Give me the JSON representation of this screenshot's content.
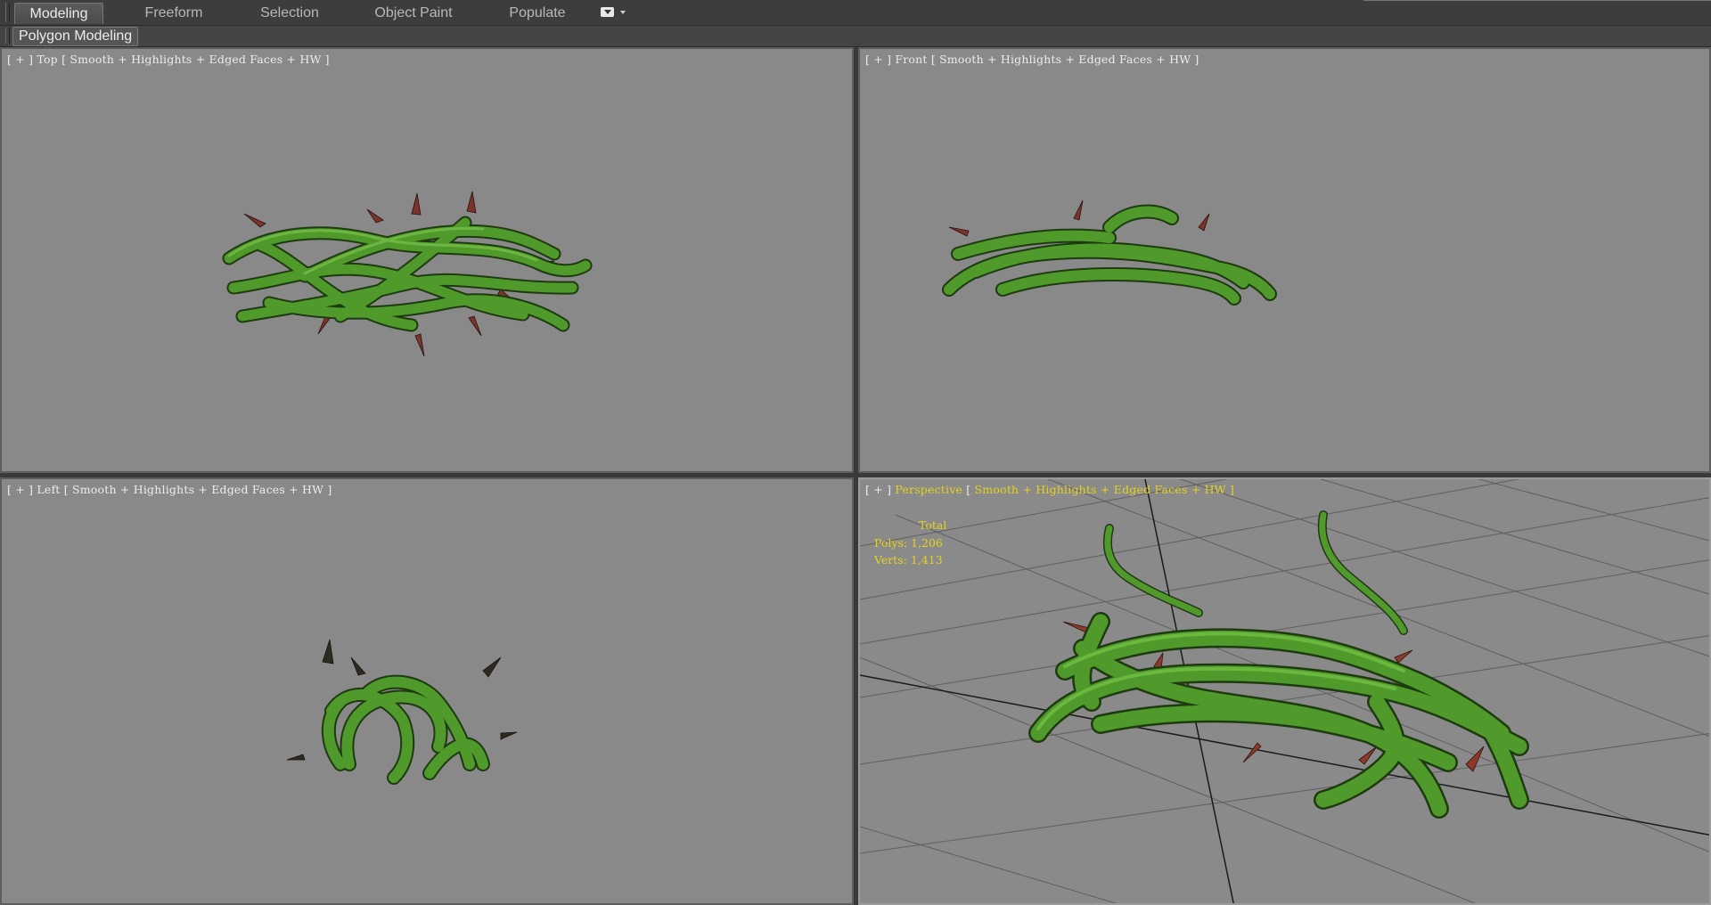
{
  "ribbon": {
    "tabs": [
      {
        "label": "Modeling",
        "active": true
      },
      {
        "label": "Freeform",
        "active": false
      },
      {
        "label": "Selection",
        "active": false
      },
      {
        "label": "Object Paint",
        "active": false
      },
      {
        "label": "Populate",
        "active": false
      }
    ],
    "panel_label": "Polygon Modeling"
  },
  "viewports": {
    "top": {
      "plus": "[ + ]",
      "view": "Top",
      "mode_open": "[",
      "shading": "Smooth + Highlights + Edged Faces + HW ]"
    },
    "front": {
      "plus": "[ + ]",
      "view": "Front",
      "mode_open": "[",
      "shading": "Smooth + Highlights + Edged Faces + HW ]"
    },
    "left": {
      "plus": "[ + ]",
      "view": "Left",
      "mode_open": "[",
      "shading": "Smooth + Highlights + Edged Faces + HW ]"
    },
    "perspective": {
      "plus": "[ + ]",
      "view": "Perspective",
      "mode_open": "[",
      "shading": "Smooth + Highlights + Edged Faces + HW ]",
      "stats": {
        "header": "Total",
        "polys": "Polys: 1,206",
        "verts": "Verts: 1,413"
      }
    }
  },
  "colors": {
    "viewport_bg": "#898989",
    "vine_green": "#4f9a2a",
    "thorn_red": "#8e3a2a",
    "label_yellow": "#e5d21c",
    "ui_dark": "#3d3d3d"
  }
}
